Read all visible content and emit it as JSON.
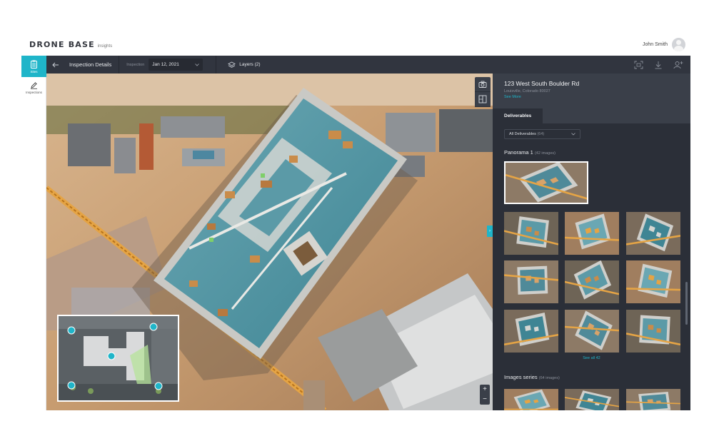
{
  "brand": {
    "name": "DRONE BASE",
    "product": "insights"
  },
  "user": {
    "name": "John Smith"
  },
  "rail": {
    "items": [
      {
        "label": "Sites",
        "icon": "clipboard-icon",
        "active": true
      },
      {
        "label": "Inspections",
        "icon": "pencil-icon",
        "active": false
      }
    ]
  },
  "topbar": {
    "title": "Inspection Details",
    "inspection_label": "Inspection",
    "date": "Jan 12, 2021",
    "layers": "Layers (2)"
  },
  "site": {
    "address": "123 West South Boulder Rd",
    "city": "Louisville, Colorado 80027",
    "see_more": "See More"
  },
  "panel": {
    "tab": "Deliverables",
    "filter_label": "All Deliverables",
    "filter_count": "(64)",
    "panorama_title": "Panorama 1",
    "panorama_count": "(42 images)",
    "see_all": "See all 42",
    "series_title": "Images series",
    "series_count": "(64 images)"
  },
  "colors": {
    "accent": "#1fb5c9",
    "bar": "#31353f",
    "panel": "#2b2f38",
    "panel_head": "#3a3f49"
  }
}
